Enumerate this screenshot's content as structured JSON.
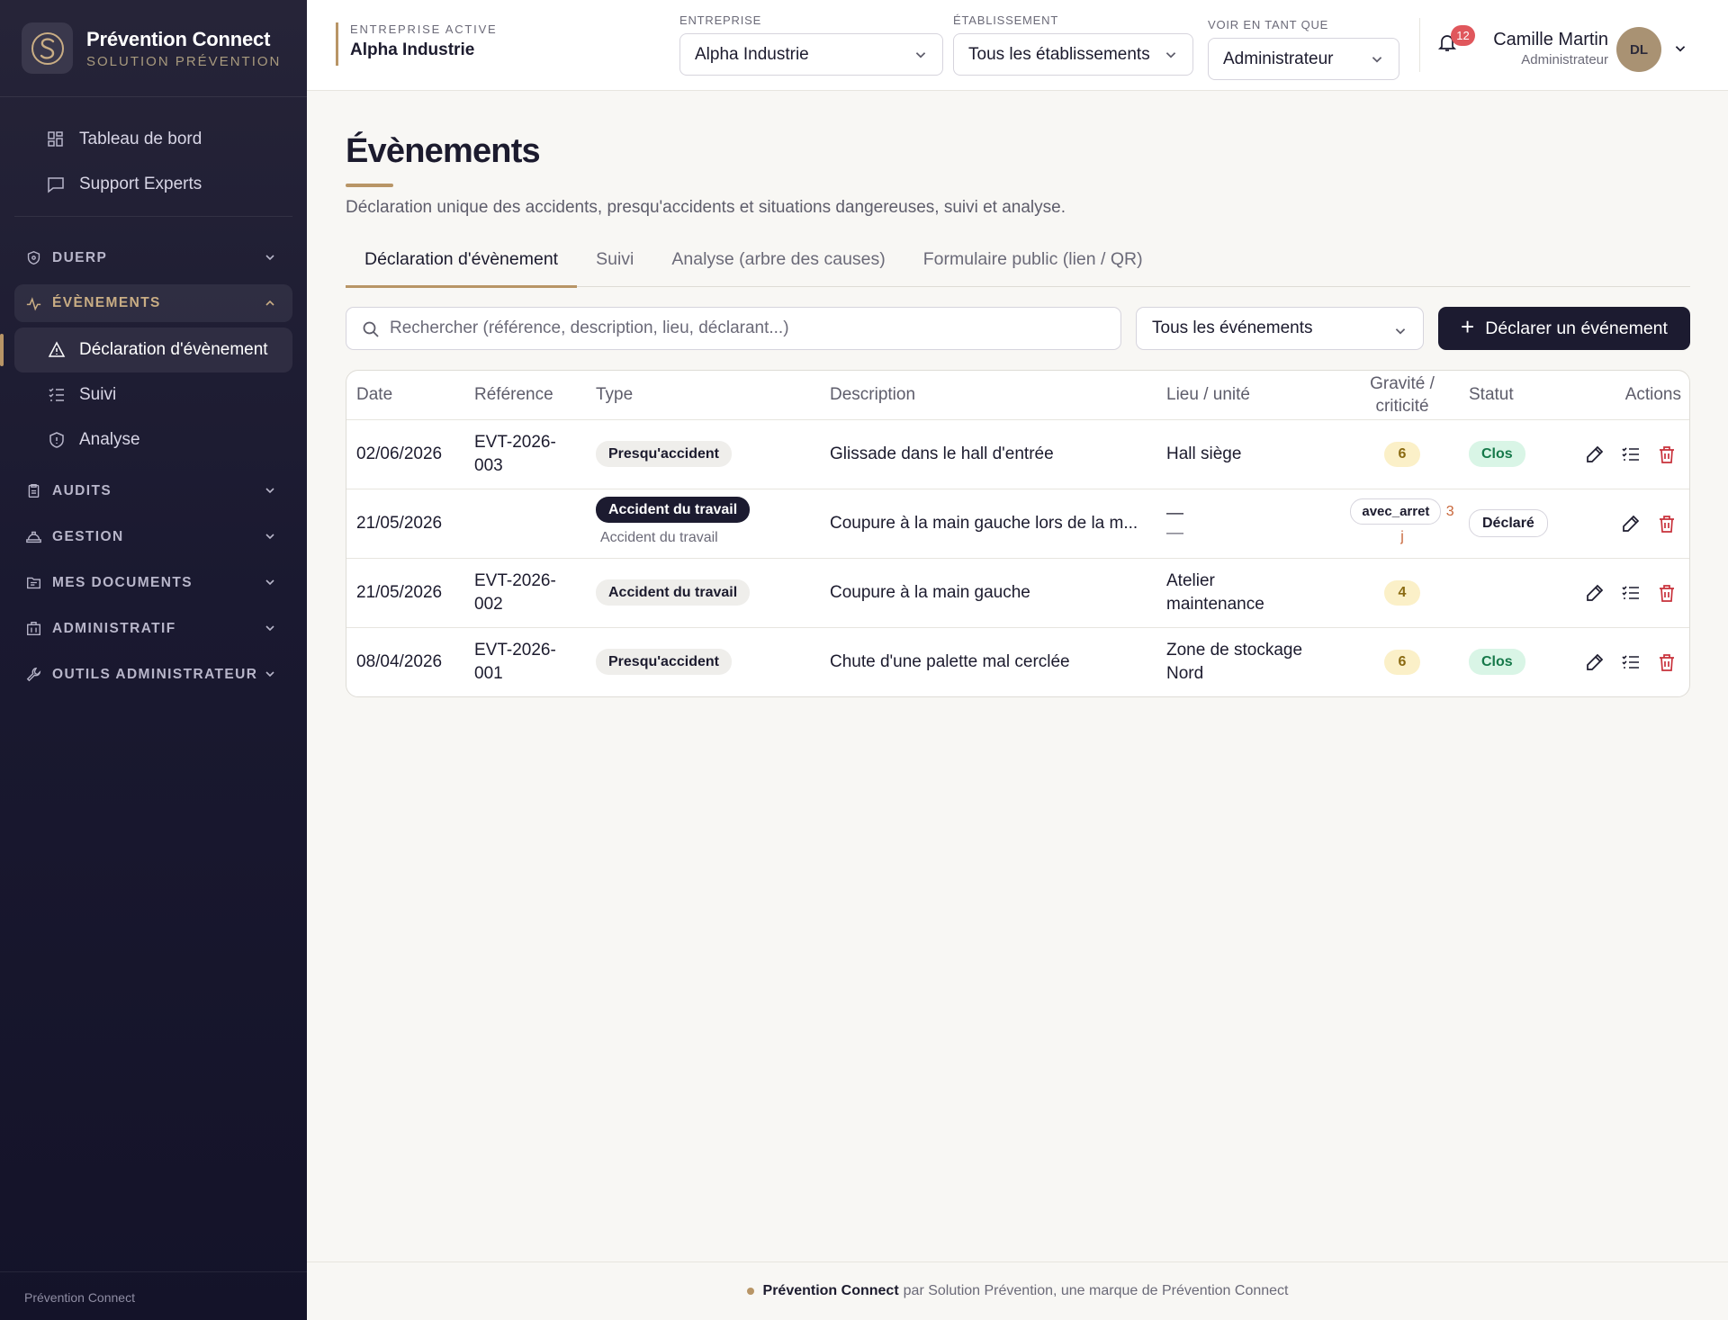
{
  "brand": {
    "name": "Prévention Connect",
    "subtitle": "SOLUTION PRÉVENTION"
  },
  "sidebar": {
    "top_items": [
      {
        "label": "Tableau de bord",
        "icon": "dashboard-icon"
      },
      {
        "label": "Support Experts",
        "icon": "chat-icon"
      }
    ],
    "sections": {
      "duerp": "DUERP",
      "evenements": "ÉVÈNEMENTS",
      "audits": "AUDITS",
      "gestion": "GESTION",
      "documents": "MES DOCUMENTS",
      "administratif": "ADMINISTRATIF",
      "outils": "OUTILS ADMINISTRATEUR"
    },
    "evenements_items": [
      {
        "label": "Déclaration d'évènement",
        "active": true
      },
      {
        "label": "Suivi"
      },
      {
        "label": "Analyse"
      }
    ],
    "footer": "Prévention Connect"
  },
  "header": {
    "active_company_caption": "ENTREPRISE ACTIVE",
    "active_company": "Alpha Industrie",
    "entreprise_caption": "ENTREPRISE",
    "entreprise_value": "Alpha Industrie",
    "etablissement_caption": "ÉTABLISSEMENT",
    "etablissement_value": "Tous les établissements",
    "voir_caption": "VOIR EN TANT QUE",
    "voir_value": "Administrateur",
    "notifications": "12",
    "user_name": "Camille Martin",
    "user_role": "Administrateur",
    "avatar_initials": "DL"
  },
  "page": {
    "title": "Évènements",
    "subtitle": "Déclaration unique des accidents, presqu'accidents et situations dangereuses, suivi et analyse.",
    "tabs": [
      "Déclaration d'évènement",
      "Suivi",
      "Analyse (arbre des causes)",
      "Formulaire public (lien / QR)"
    ],
    "search_placeholder": "Rechercher (référence, description, lieu, déclarant...)",
    "filter_value": "Tous les événements",
    "declare_button": "Déclarer un événement"
  },
  "table": {
    "headers": {
      "date": "Date",
      "reference": "Référence",
      "type": "Type",
      "description": "Description",
      "lieu": "Lieu / unité",
      "gravite_1": "Gravité /",
      "gravite_2": "criticité",
      "statut": "Statut",
      "actions": "Actions"
    },
    "rows": [
      {
        "date": "02/06/2026",
        "ref_1": "EVT-2026-",
        "ref_2": "003",
        "type": "Presqu'accident",
        "description": "Glissade dans le hall d'entrée",
        "lieu_1": "Hall siège",
        "lieu_2": "",
        "score": "6",
        "statut": "Clos"
      },
      {
        "date": "21/05/2026",
        "type": "Accident du travail",
        "subtype": "Accident du travail",
        "description": "Coupure à la main gauche lors de la m...",
        "lieu_1": "—",
        "lieu_2": "—",
        "arret": "avec_arret",
        "arret_days": "3",
        "arret_unit": "j",
        "statut": "Déclaré"
      },
      {
        "date": "21/05/2026",
        "ref_1": "EVT-2026-",
        "ref_2": "002",
        "type": "Accident du travail",
        "description": "Coupure à la main gauche",
        "lieu_1": "Atelier",
        "lieu_2": "maintenance",
        "score": "4",
        "statut": ""
      },
      {
        "date": "08/04/2026",
        "ref_1": "EVT-2026-",
        "ref_2": "001",
        "type": "Presqu'accident",
        "description": "Chute d'une palette mal cerclée",
        "lieu_1": "Zone de stockage",
        "lieu_2": "Nord",
        "score": "6",
        "statut": "Clos"
      }
    ]
  },
  "footer": {
    "brand": "Prévention Connect",
    "text": "par Solution Prévention, une marque de Prévention Connect"
  },
  "colors": {
    "accent": "#b89566",
    "sidebar_bg": "#1a1930",
    "primary_button": "#1c1b30",
    "danger": "#c8303a"
  }
}
